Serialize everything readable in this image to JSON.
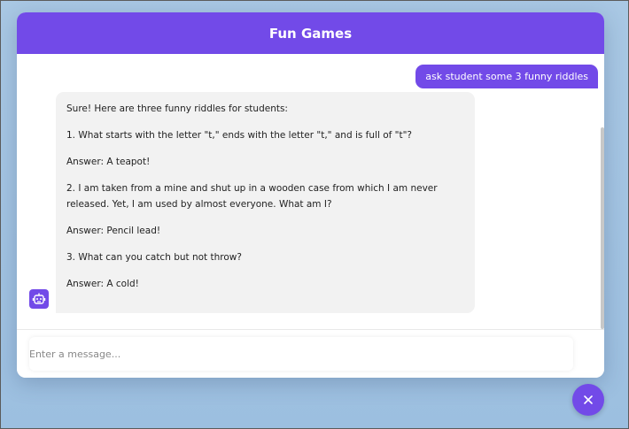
{
  "header": {
    "title": "Fun Games"
  },
  "messages": {
    "outgoing": "ask student some 3 funny riddles",
    "incoming": [
      "Sure! Here are three funny riddles for students:",
      "1. What starts with the letter \"t,\" ends with the letter \"t,\" and is full of \"t\"?",
      "Answer: A teapot!",
      "2. I am taken from a mine and shut up in a wooden case from which I am never released. Yet, I am used by almost everyone. What am I?",
      "Answer: Pencil lead!",
      "3. What can you catch but not throw?",
      "Answer: A cold!"
    ]
  },
  "input": {
    "placeholder": "Enter a message...",
    "value": ""
  },
  "icons": {
    "bot": "robot-icon",
    "close": "close-icon"
  },
  "colors": {
    "accent": "#724ae8",
    "bubble": "#f2f2f2",
    "background": "#a9c8e4"
  }
}
